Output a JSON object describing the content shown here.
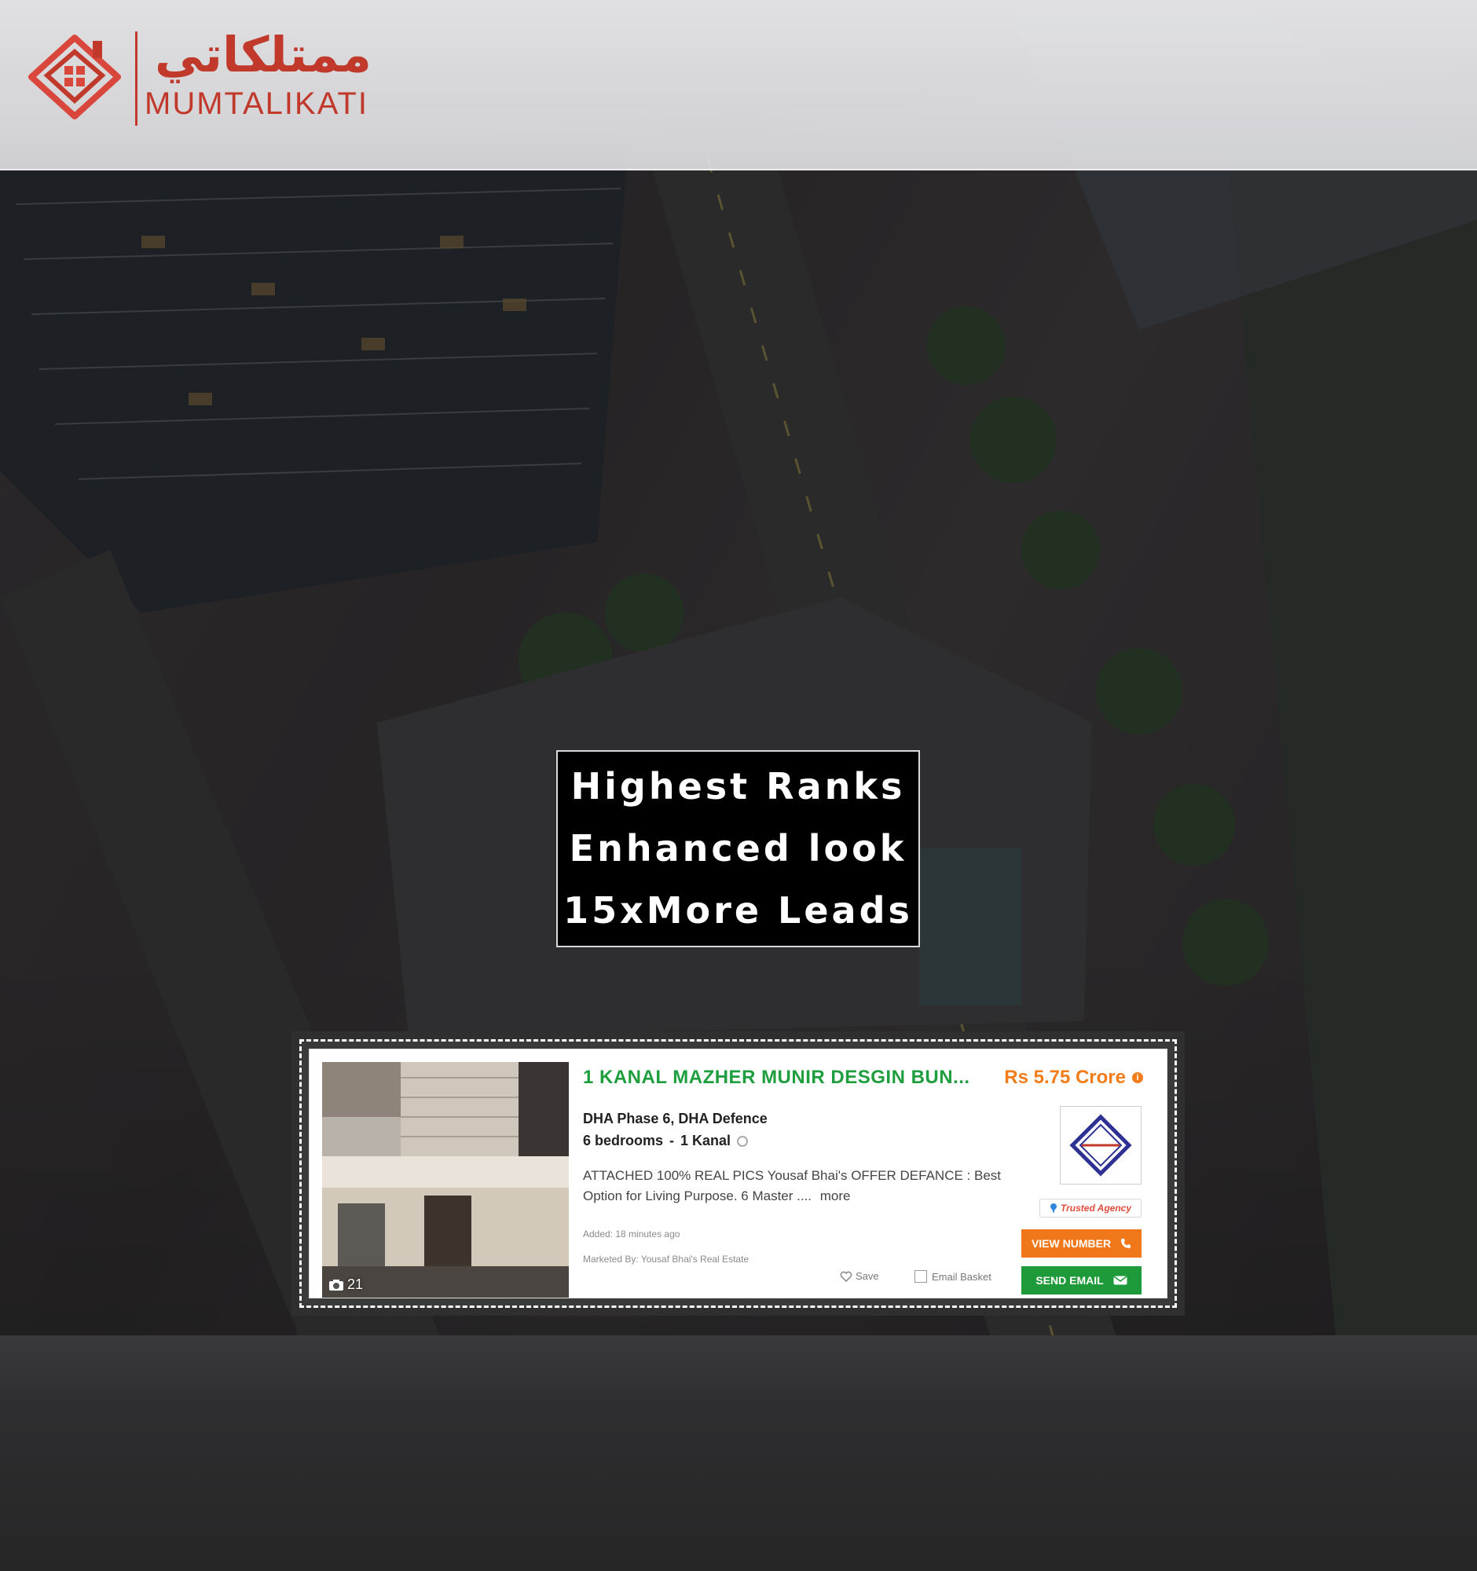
{
  "brand": {
    "name_arabic": "ممتلكاتي",
    "name_latin": "MUMTALIKATI",
    "color": "#c0392b"
  },
  "promo": {
    "lines": [
      "Highest Ranks",
      "Enhanced look",
      "15xMore Leads"
    ]
  },
  "listing": {
    "title": "1 KANAL MAZHER MUNIR DESGIN BUN...",
    "price": "Rs 5.75 Crore",
    "location": "DHA Phase 6, DHA Defence",
    "bedrooms": "6 bedrooms",
    "separator": "-",
    "area": "1 Kanal",
    "description": "ATTACHED 100% REAL PICS Yousaf Bhai's OFFER DEFANCE : Best Option for Living Purpose. 6 Master ....",
    "more_label": "more",
    "added": "Added: 18 minutes ago",
    "marketed_by": "Marketed By: Yousaf Bhai's Real Estate",
    "photo_count": "21",
    "save_label": "Save",
    "basket_label": "Email Basket",
    "trusted_label": "Trusted Agency",
    "view_number_label": "VIEW NUMBER",
    "send_email_label": "SEND EMAIL",
    "title_color": "#1e9e3e",
    "price_color": "#f07d1a",
    "icons": {
      "camera": "camera-icon",
      "info": "info-icon",
      "heart": "heart-icon",
      "phone": "phone-icon",
      "mail": "mail-icon",
      "pin": "pin-icon"
    }
  }
}
